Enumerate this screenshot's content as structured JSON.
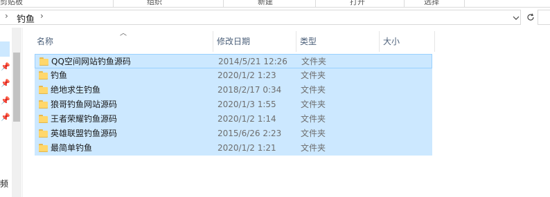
{
  "ribbon": {
    "labels": [
      "剪贴板",
      "组织",
      "新建",
      "打开",
      "选择"
    ]
  },
  "address": {
    "path": [
      "钓鱼"
    ],
    "chevron": "›",
    "dropdown_icon": "chevron-down-icon",
    "refresh_icon": "refresh-icon"
  },
  "nav": {
    "truncated_label": "频"
  },
  "columns": {
    "name": "名称",
    "date_modified": "修改日期",
    "type": "类型",
    "size": "大小",
    "sorted_by": "name"
  },
  "files": [
    {
      "name": "QQ空间网站钓鱼源码",
      "date": "2014/5/21 12:26",
      "type": "文件夹",
      "selected": true,
      "focused": true
    },
    {
      "name": "钓鱼",
      "date": "2020/1/2 1:23",
      "type": "文件夹",
      "selected": true
    },
    {
      "name": "绝地求生钓鱼",
      "date": "2018/2/17 0:34",
      "type": "文件夹",
      "selected": true
    },
    {
      "name": "狼哥钓鱼网站源码",
      "date": "2020/1/3 1:55",
      "type": "文件夹",
      "selected": true
    },
    {
      "name": "王者荣耀钓鱼源码",
      "date": "2020/1/2 1:14",
      "type": "文件夹",
      "selected": true
    },
    {
      "name": "英雄联盟钓鱼源码",
      "date": "2015/6/26 2:23",
      "type": "文件夹",
      "selected": true
    },
    {
      "name": "最简单钓鱼",
      "date": "2020/1/2 1:21",
      "type": "文件夹",
      "selected": true
    }
  ]
}
